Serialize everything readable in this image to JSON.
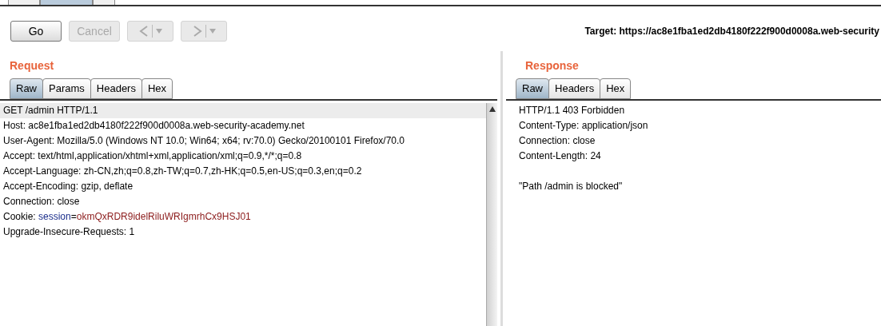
{
  "top_tabs": [
    {
      "selected": false
    },
    {
      "selected": true
    },
    {
      "selected": false
    }
  ],
  "toolbar": {
    "buttons": [
      {
        "kind": "text",
        "label": "Go",
        "disabled": false
      },
      {
        "kind": "text",
        "label": "Cancel",
        "disabled": true
      },
      {
        "kind": "back",
        "disabled": true
      },
      {
        "kind": "forward",
        "disabled": true
      }
    ],
    "target": "Target: https://ac8e1fba1ed2db4180f222f900d0008a.web-security"
  },
  "request": {
    "title": "Request",
    "tabs": [
      {
        "label": "Raw",
        "selected": true
      },
      {
        "label": "Params",
        "selected": false
      },
      {
        "label": "Headers",
        "selected": false
      },
      {
        "label": "Hex",
        "selected": false
      }
    ],
    "lines": [
      {
        "parts": [
          {
            "kind": "plain",
            "text": "GET /admin HTTP/1.1"
          }
        ]
      },
      {
        "parts": [
          {
            "kind": "plain",
            "text": "Host: ac8e1fba1ed2db4180f222f900d0008a.web-security-academy.net"
          }
        ]
      },
      {
        "parts": [
          {
            "kind": "plain",
            "text": "User-Agent: Mozilla/5.0 (Windows NT 10.0; Win64; x64; rv:70.0) Gecko/20100101 Firefox/70.0"
          }
        ]
      },
      {
        "parts": [
          {
            "kind": "plain",
            "text": "Accept: text/html,application/xhtml+xml,application/xml;q=0.9,*/*;q=0.8"
          }
        ]
      },
      {
        "parts": [
          {
            "kind": "plain",
            "text": "Accept-Language: zh-CN,zh;q=0.8,zh-TW;q=0.7,zh-HK;q=0.5,en-US;q=0.3,en;q=0.2"
          }
        ]
      },
      {
        "parts": [
          {
            "kind": "plain",
            "text": "Accept-Encoding: gzip, deflate"
          }
        ]
      },
      {
        "parts": [
          {
            "kind": "plain",
            "text": "Connection: close"
          }
        ]
      },
      {
        "parts": [
          {
            "kind": "plain",
            "text": "Cookie: "
          },
          {
            "kind": "name",
            "text": "session"
          },
          {
            "kind": "plain",
            "text": "="
          },
          {
            "kind": "value",
            "text": "okmQxRDR9idelRiluWRIgmrhCx9HSJ01"
          }
        ]
      },
      {
        "parts": [
          {
            "kind": "plain",
            "text": "Upgrade-Insecure-Requests: 1"
          }
        ]
      }
    ]
  },
  "response": {
    "title": "Response",
    "tabs": [
      {
        "label": "Raw",
        "selected": true
      },
      {
        "label": "Headers",
        "selected": false
      },
      {
        "label": "Hex",
        "selected": false
      }
    ],
    "header_lines": [
      "HTTP/1.1 403 Forbidden",
      "Content-Type: application/json",
      "Connection: close",
      "Content-Length: 24"
    ],
    "body": "\"Path /admin is blocked\""
  }
}
